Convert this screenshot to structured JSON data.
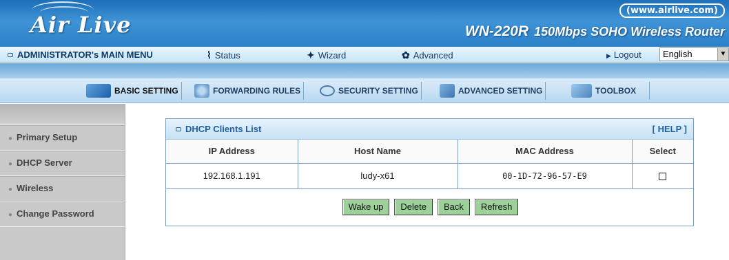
{
  "header": {
    "logo": "Air Live",
    "website": "(www.airlive.com)",
    "model": "WN-220R",
    "description": "150Mbps SOHO Wireless Router"
  },
  "menubar": {
    "admin_label": "ADMINISTRATOR's MAIN MENU",
    "status_label": "Status",
    "wizard_label": "Wizard",
    "advanced_label": "Advanced",
    "logout_label": "Logout",
    "language": "English"
  },
  "tabs": [
    {
      "label": "BASIC SETTING",
      "icon": "basic-setting-icon"
    },
    {
      "label": "FORWARDING RULES",
      "icon": "forwarding-rules-icon"
    },
    {
      "label": "SECURITY SETTING",
      "icon": "security-setting-icon"
    },
    {
      "label": "ADVANCED SETTING",
      "icon": "advanced-setting-icon"
    },
    {
      "label": "TOOLBOX",
      "icon": "toolbox-icon"
    }
  ],
  "sidebar": {
    "items": [
      {
        "label": "Primary Setup"
      },
      {
        "label": "DHCP Server"
      },
      {
        "label": "Wireless"
      },
      {
        "label": "Change Password"
      }
    ]
  },
  "panel": {
    "title": "DHCP Clients List",
    "help": "[ HELP ]",
    "columns": [
      "IP Address",
      "Host Name",
      "MAC Address",
      "Select"
    ],
    "rows": [
      {
        "ip": "192.168.1.191",
        "host": "ludy-x61",
        "mac": "00-1D-72-96-57-E9",
        "selected": false
      }
    ],
    "buttons": {
      "wake": "Wake up",
      "delete": "Delete",
      "back": "Back",
      "refresh": "Refresh"
    }
  },
  "colors": {
    "header_blue": "#2b80c8",
    "panel_title": "#1f5fa0",
    "button_green": "#9ed09a",
    "sidebar_gray": "#c9c9c9"
  }
}
